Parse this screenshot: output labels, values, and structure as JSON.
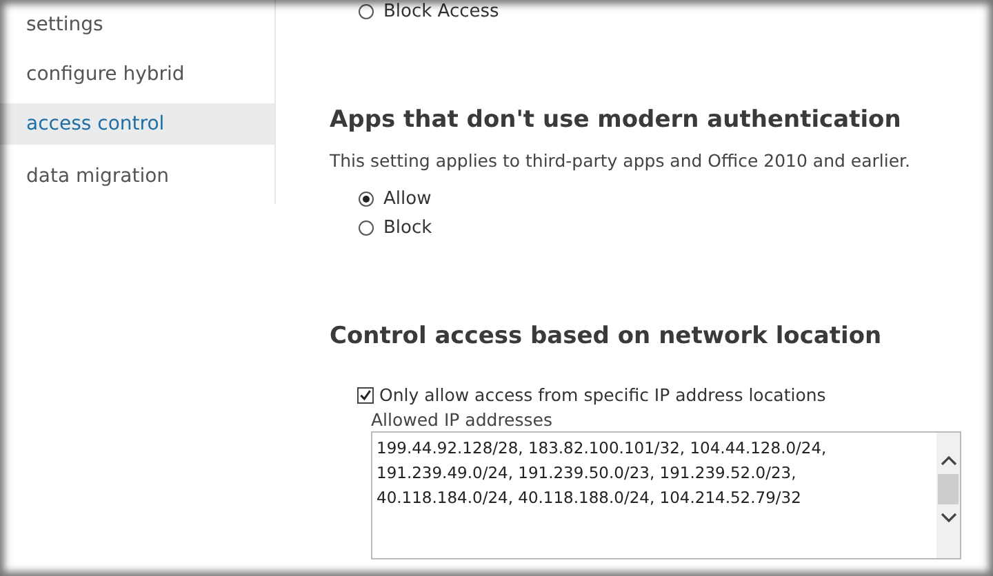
{
  "sidebar": {
    "items": [
      {
        "label": "settings",
        "selected": false
      },
      {
        "label": "configure hybrid",
        "selected": false
      },
      {
        "label": "access control",
        "selected": true
      },
      {
        "label": "data migration",
        "selected": false
      }
    ]
  },
  "top_radios": [
    {
      "label": "Block Access",
      "selected": false
    }
  ],
  "sections": [
    {
      "heading": "Apps that don't use modern authentication",
      "description": "This setting applies to third-party apps and Office 2010 and earlier.",
      "radios": [
        {
          "label": "Allow",
          "selected": true
        },
        {
          "label": "Block",
          "selected": false
        }
      ]
    },
    {
      "heading": "Control access based on network location",
      "checkbox": {
        "label": "Only allow access from specific IP address locations",
        "checked": true
      },
      "field": {
        "label": "Allowed IP addresses",
        "value": "199.44.92.128/28, 183.82.100.101/32, 104.44.128.0/24,\n191.239.49.0/24, 191.239.50.0/23, 191.239.52.0/23,\n40.118.184.0/24, 40.118.188.0/24, 104.214.52.79/32"
      }
    }
  ]
}
